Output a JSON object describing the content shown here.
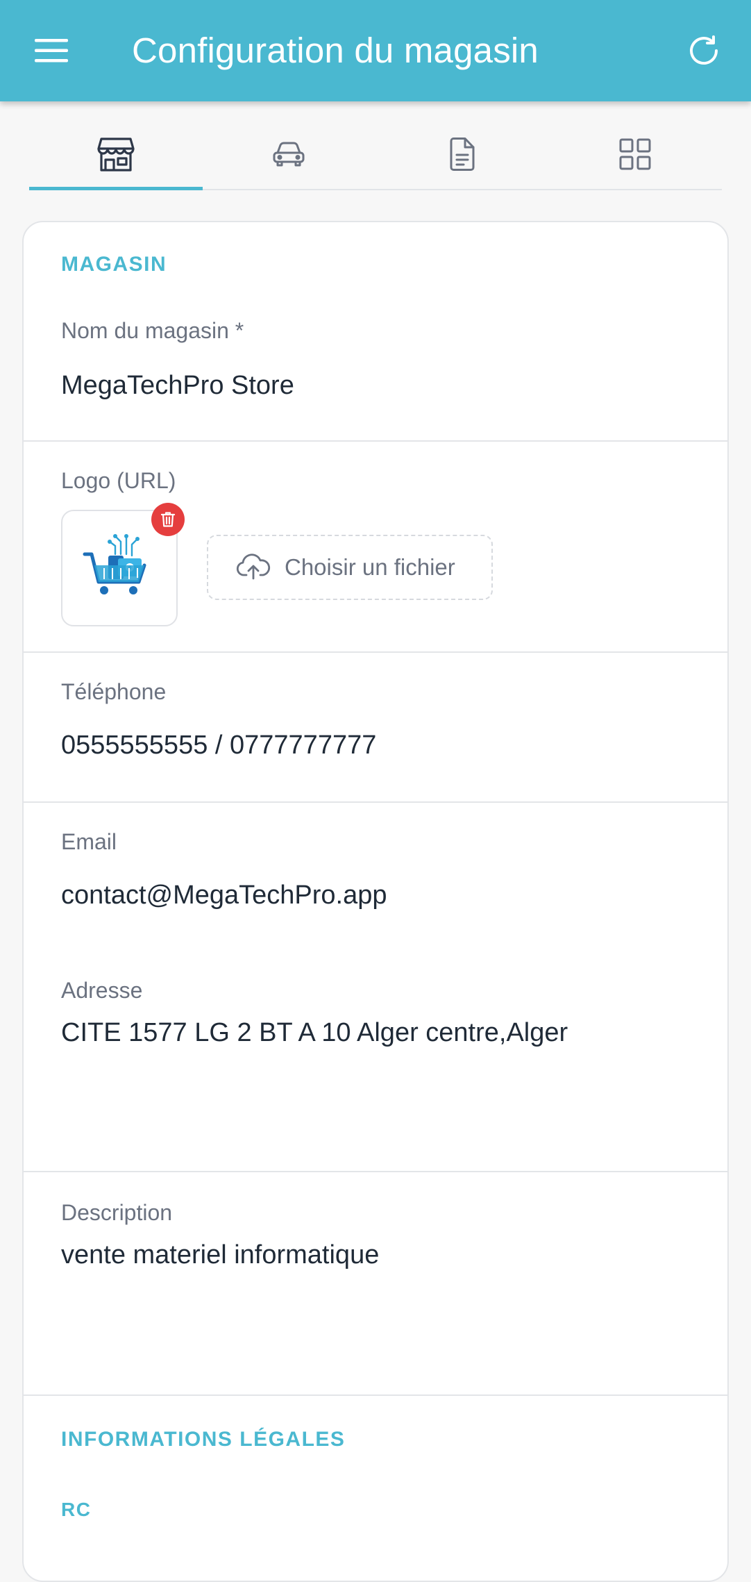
{
  "appbar": {
    "title": "Configuration du magasin",
    "menu_icon": "hamburger-menu-icon",
    "refresh_icon": "refresh-icon",
    "background": "#4ab8d0"
  },
  "tabs": [
    {
      "icon": "store-icon",
      "active": true
    },
    {
      "icon": "car-icon",
      "active": false
    },
    {
      "icon": "document-icon",
      "active": false
    },
    {
      "icon": "grid-icon",
      "active": false
    }
  ],
  "store_section": {
    "heading": "MAGASIN",
    "name": {
      "label": "Nom du magasin *",
      "value": "MegaTechPro Store"
    },
    "logo": {
      "label": "Logo (URL)",
      "upload_label": "Choisir un fichier",
      "upload_icon": "cloud-upload-icon",
      "delete_icon": "trash-icon"
    },
    "phone": {
      "label": "Téléphone",
      "value": "0555555555 / 0777777777"
    },
    "email": {
      "label": "Email",
      "value": "contact@MegaTechPro.app"
    },
    "address": {
      "label": "Adresse",
      "value": "CITE 1577 LG 2 BT A 10 Alger centre,Alger"
    },
    "description": {
      "label": "Description",
      "value": "vente materiel informatique"
    }
  },
  "legal_section": {
    "heading": "INFORMATIONS LÉGALES",
    "rc_label": "RC"
  },
  "colors": {
    "accent": "#4ab8d0",
    "danger": "#e53e3e",
    "label": "#6b7280",
    "text": "#1f2a37"
  }
}
